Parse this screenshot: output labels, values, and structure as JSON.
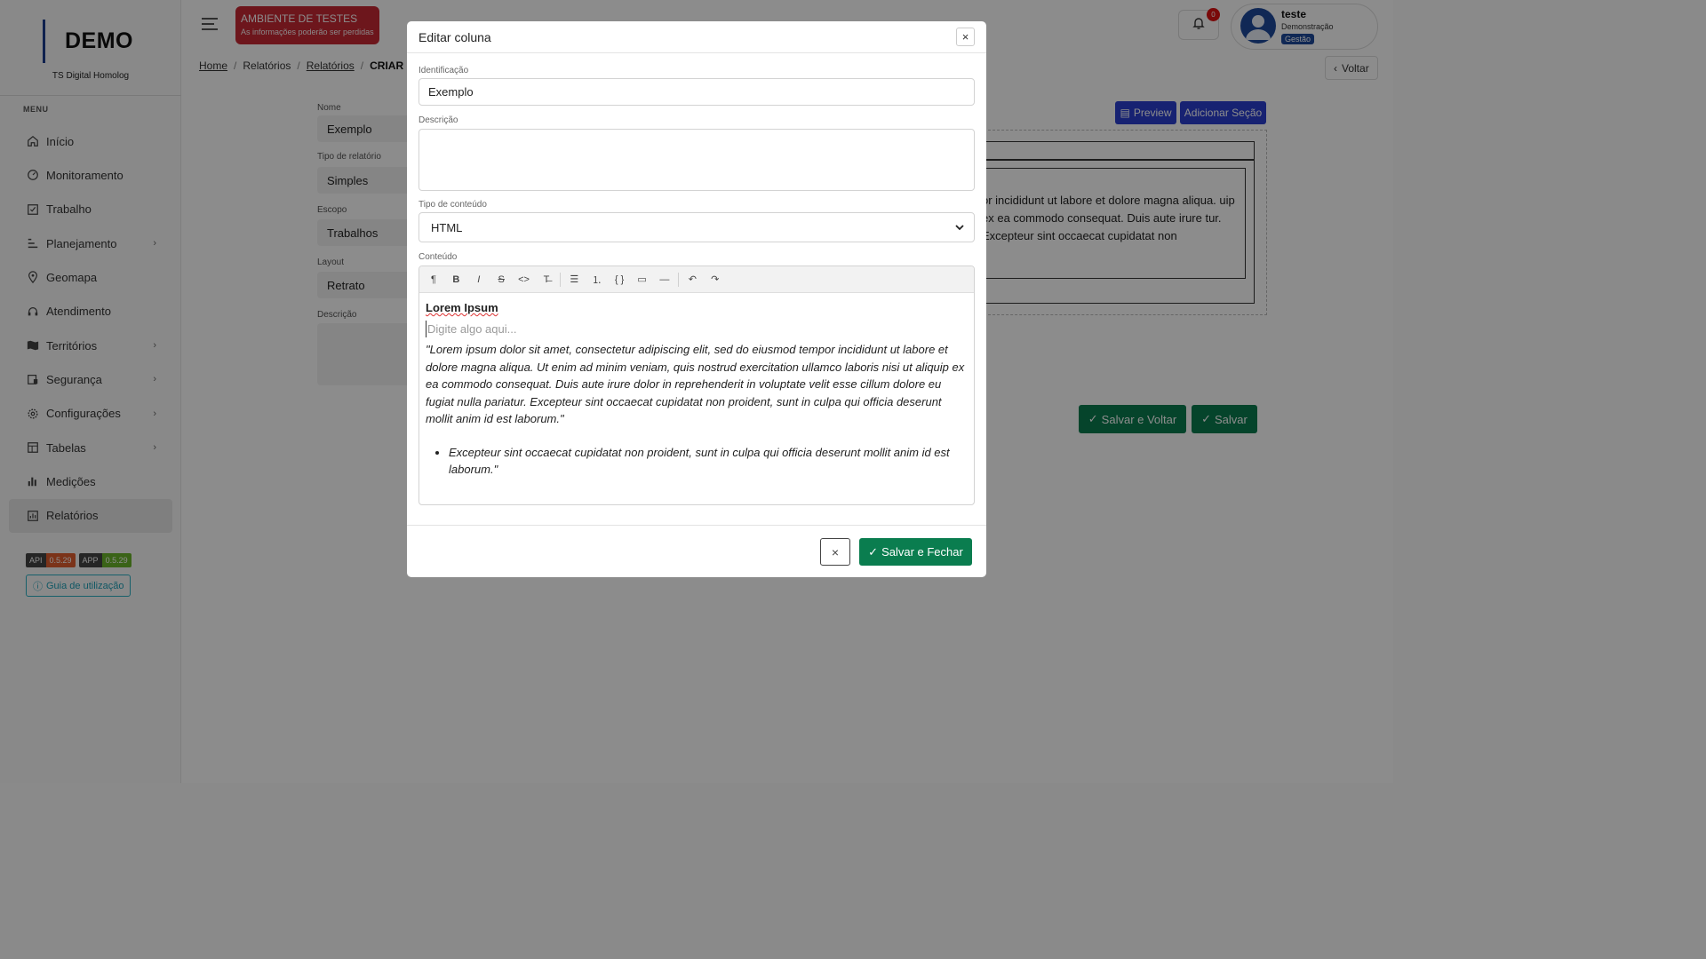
{
  "sidebar": {
    "logo": "DEMO",
    "subtitle": "TS Digital Homolog",
    "menu_caption": "MENU",
    "items": [
      {
        "label": "Início",
        "icon": "home-icon"
      },
      {
        "label": "Monitoramento",
        "icon": "gauge-icon"
      },
      {
        "label": "Trabalho",
        "icon": "checkbox-icon"
      },
      {
        "label": "Planejamento",
        "icon": "planning-icon",
        "has_children": true
      },
      {
        "label": "Geomapa",
        "icon": "map-pin-icon"
      },
      {
        "label": "Atendimento",
        "icon": "headset-icon"
      },
      {
        "label": "Territórios",
        "icon": "map-icon",
        "has_children": true
      },
      {
        "label": "Segurança",
        "icon": "security-icon",
        "has_children": true
      },
      {
        "label": "Configurações",
        "icon": "gear-icon",
        "has_children": true
      },
      {
        "label": "Tabelas",
        "icon": "table-icon",
        "has_children": true
      },
      {
        "label": "Medições",
        "icon": "bar-chart-icon"
      },
      {
        "label": "Relatórios",
        "icon": "report-icon",
        "active": true
      }
    ],
    "versions": {
      "api_key": "API",
      "api_version": "0.5.29",
      "app_key": "APP",
      "app_version": "0.5.29"
    },
    "guide_label": "Guia de utilização"
  },
  "topbar": {
    "env_title": "AMBIENTE DE TESTES",
    "env_subtitle": "As informações poderão ser perdidas",
    "breadcrumb": {
      "home": "Home",
      "reports": "Relatórios",
      "reports_link": "Relatórios",
      "current": "CRIAR RE"
    },
    "notifications_count": "0",
    "user": {
      "name": "teste",
      "org": "Demonstração",
      "role": "Gestão"
    },
    "back_label": "Voltar"
  },
  "form_bg": {
    "name_label": "Nome",
    "name_value": "Exemplo",
    "type_label": "Tipo de relatório",
    "type_value": "Simples",
    "scope_label": "Escopo",
    "scope_value": "Trabalhos",
    "layout_label": "Layout",
    "layout_value": "Retrato",
    "desc_label": "Descrição",
    "preview_label": "Preview",
    "add_section_label": "Adicionar Seção",
    "preview_text": "or incididunt ut labore et dolore magna aliqua. uip ex ea commodo consequat. Duis aute irure tur. Excepteur sint occaecat cupidatat non",
    "save_back_label": "Salvar e Voltar",
    "save_label": "Salvar"
  },
  "modal": {
    "title": "Editar coluna",
    "identification_label": "Identificação",
    "identification_value": "Exemplo",
    "description_label": "Descrição",
    "description_value": "",
    "content_type_label": "Tipo de conteúdo",
    "content_type_value": "HTML",
    "content_label": "Conteúdo",
    "toolbar": [
      "paragraph-icon",
      "bold-icon",
      "italic-icon",
      "strikethrough-icon",
      "code-icon",
      "clear-format-icon",
      "bullet-list-icon",
      "ordered-list-icon",
      "code-block-icon",
      "blockquote-icon",
      "horizontal-rule-icon",
      "undo-icon",
      "redo-icon"
    ],
    "editor": {
      "heading": "Lorem Ipsum",
      "placeholder": "Digite algo aqui...",
      "quote": "\"Lorem ipsum dolor sit amet, consectetur adipiscing elit, sed do eiusmod tempor incididunt ut labore et dolore magna aliqua. Ut enim ad minim veniam, quis nostrud exercitation ullamco laboris nisi ut aliquip ex ea commodo consequat. Duis aute irure dolor in reprehenderit in voluptate velit esse cillum dolore eu fugiat nulla pariatur. Excepteur sint occaecat cupidatat non proident, sunt in culpa qui officia deserunt mollit anim id est laborum.\"",
      "bullet": "Excepteur sint occaecat cupidatat non proident, sunt in culpa qui officia deserunt mollit anim id est laborum.\""
    },
    "save_close_label": "Salvar e Fechar"
  },
  "colors": {
    "primary_green": "#0a7d4f",
    "primary_blue": "#2a3fcf",
    "env_red": "#c62834",
    "brand_blue": "#1e4a9c"
  }
}
